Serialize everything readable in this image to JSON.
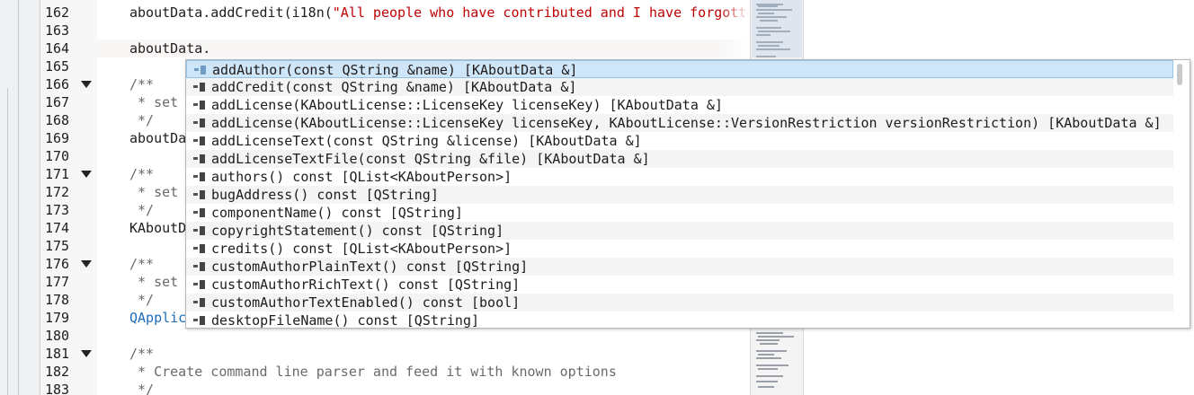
{
  "editor": {
    "lines": [
      {
        "num": "162",
        "fold": false,
        "segments": [
          {
            "t": "aboutData.addCredit(i18n(",
            "c": ""
          },
          {
            "t": "\"All people who have contributed and I have forgotte",
            "c": "str"
          }
        ]
      },
      {
        "num": "163",
        "fold": false,
        "segments": []
      },
      {
        "num": "164",
        "fold": false,
        "segments": [
          {
            "t": "aboutData.",
            "c": ""
          }
        ]
      },
      {
        "num": "165",
        "fold": false,
        "segments": []
      },
      {
        "num": "166",
        "fold": true,
        "segments": [
          {
            "t": "/**",
            "c": "cmt"
          }
        ]
      },
      {
        "num": "167",
        "fold": false,
        "segments": [
          {
            "t": " * set",
            "c": "cmt"
          }
        ]
      },
      {
        "num": "168",
        "fold": false,
        "segments": [
          {
            "t": " */",
            "c": "cmt"
          }
        ]
      },
      {
        "num": "169",
        "fold": false,
        "segments": [
          {
            "t": "aboutDa",
            "c": ""
          }
        ]
      },
      {
        "num": "170",
        "fold": false,
        "segments": []
      },
      {
        "num": "171",
        "fold": true,
        "segments": [
          {
            "t": "/**",
            "c": "cmt"
          }
        ]
      },
      {
        "num": "172",
        "fold": false,
        "segments": [
          {
            "t": " * set",
            "c": "cmt"
          }
        ]
      },
      {
        "num": "173",
        "fold": false,
        "segments": [
          {
            "t": " */",
            "c": "cmt"
          }
        ]
      },
      {
        "num": "174",
        "fold": false,
        "segments": [
          {
            "t": "KAboutD",
            "c": ""
          }
        ]
      },
      {
        "num": "175",
        "fold": false,
        "segments": []
      },
      {
        "num": "176",
        "fold": true,
        "segments": [
          {
            "t": "/**",
            "c": "cmt"
          }
        ]
      },
      {
        "num": "177",
        "fold": false,
        "segments": [
          {
            "t": " * set",
            "c": "cmt"
          }
        ]
      },
      {
        "num": "178",
        "fold": false,
        "segments": [
          {
            "t": " */",
            "c": "cmt"
          }
        ]
      },
      {
        "num": "179",
        "fold": false,
        "segments": [
          {
            "t": "QApplic",
            "c": "blue"
          }
        ]
      },
      {
        "num": "180",
        "fold": false,
        "segments": []
      },
      {
        "num": "181",
        "fold": true,
        "segments": [
          {
            "t": "/**",
            "c": "cmt"
          }
        ]
      },
      {
        "num": "182",
        "fold": false,
        "segments": [
          {
            "t": " * Create command line parser and feed it with known options",
            "c": "cmt"
          }
        ]
      },
      {
        "num": "183",
        "fold": false,
        "segments": [
          {
            "t": " */",
            "c": "cmt"
          }
        ]
      }
    ]
  },
  "completion": {
    "items": [
      "addAuthor(const QString &name) [KAboutData &]",
      "addCredit(const QString &name) [KAboutData &]",
      "addLicense(KAboutLicense::LicenseKey licenseKey) [KAboutData &]",
      "addLicense(KAboutLicense::LicenseKey licenseKey, KAboutLicense::VersionRestriction versionRestriction) [KAboutData &]",
      "addLicenseText(const QString &license) [KAboutData &]",
      "addLicenseTextFile(const QString &file) [KAboutData &]",
      "authors() const [QList<KAboutPerson>]",
      "bugAddress() const [QString]",
      "componentName() const [QString]",
      "copyrightStatement() const [QString]",
      "credits() const [QList<KAboutPerson>]",
      "customAuthorPlainText() const [QString]",
      "customAuthorRichText() const [QString]",
      "customAuthorTextEnabled() const [bool]",
      "desktopFileName() const [QString]"
    ],
    "selected_index": 0,
    "item_icon": "method-icon"
  },
  "colors": {
    "string": "#bf0303",
    "comment": "#6a6a6a",
    "selection": "#cfe5f8"
  }
}
